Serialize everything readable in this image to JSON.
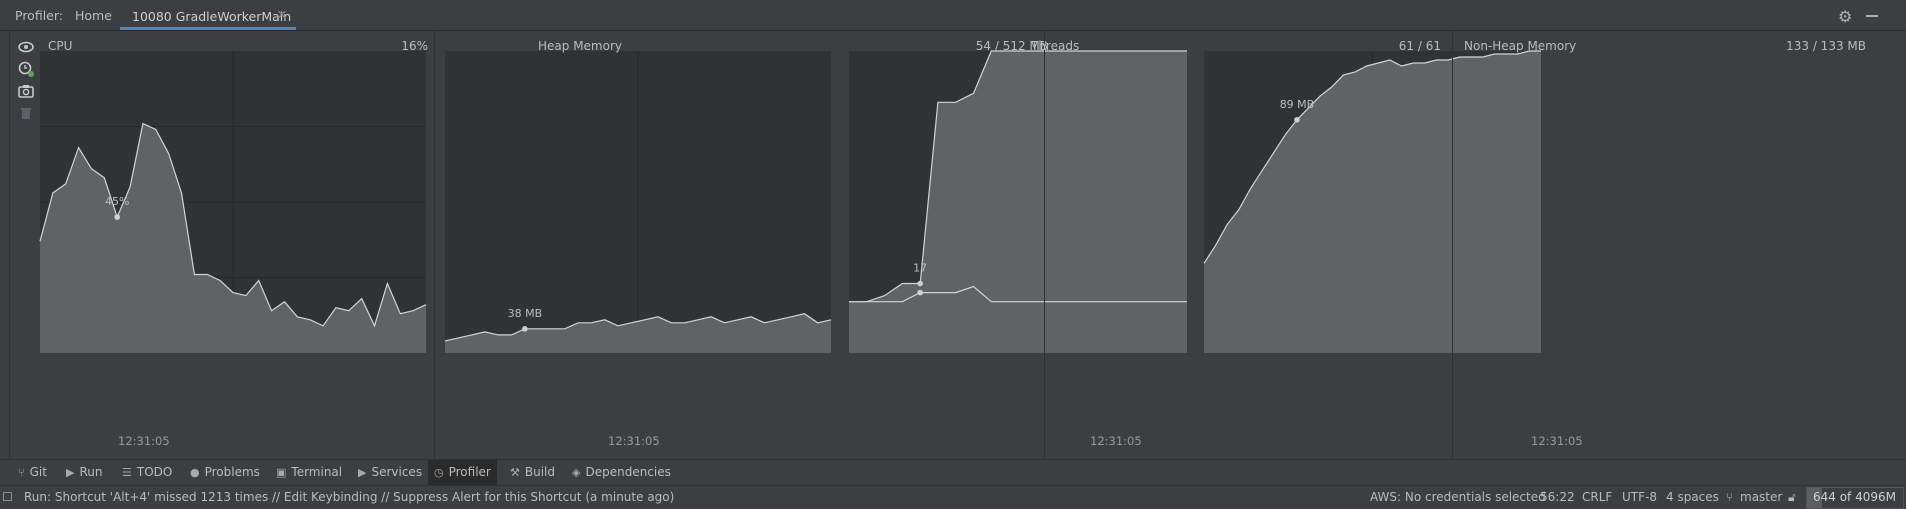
{
  "topbar": {
    "profiler_label": "Profiler:",
    "home_tab": "Home",
    "session_tab": "10080 GradleWorkerMain",
    "close_glyph": "×"
  },
  "panels": {
    "cpu": {
      "title": "CPU",
      "value": "16%",
      "marker_label": "45%",
      "time": "12:31:05"
    },
    "heap": {
      "title": "Heap Memory",
      "value": "54 / 512 MB",
      "marker_label": "38 MB",
      "time": "12:31:05"
    },
    "threads": {
      "title": "Threads",
      "value": "61 / 61",
      "marker_label": "17",
      "time": "12:31:05"
    },
    "nonheap": {
      "title": "Non-Heap Memory",
      "value": "133 / 133 MB",
      "marker_label": "89 MB",
      "time": "12:31:05"
    }
  },
  "chart_data": [
    {
      "type": "area",
      "title": "CPU",
      "unit": "%",
      "ylim": [
        0,
        100
      ],
      "values": [
        37,
        53,
        56,
        68,
        61,
        58,
        45,
        55,
        76,
        74,
        66,
        53,
        26,
        26,
        24,
        20,
        19,
        24,
        14,
        17,
        12,
        11,
        9,
        15,
        14,
        18,
        9,
        23,
        13,
        14,
        16
      ]
    },
    {
      "type": "area",
      "title": "Heap Memory",
      "unit": "MB",
      "values": [
        4,
        5,
        6,
        7,
        6,
        6,
        8,
        8,
        8,
        8,
        10,
        10,
        11,
        9,
        10,
        11,
        12,
        10,
        10,
        11,
        12,
        10,
        11,
        12,
        10,
        11,
        12,
        13,
        10,
        11
      ]
    },
    {
      "type": "area",
      "title": "Threads",
      "series": [
        {
          "name": "",
          "values": [
            17,
            17,
            19,
            23,
            23,
            83,
            83,
            86,
            100,
            100,
            100,
            100,
            100,
            100,
            100,
            100,
            100,
            100,
            100,
            100
          ]
        },
        {
          "name": "",
          "values": [
            17,
            17,
            17,
            17,
            17,
            17,
            17,
            17,
            17,
            17,
            17,
            17,
            17,
            17,
            17,
            17,
            17,
            17,
            17,
            17
          ]
        }
      ]
    },
    {
      "type": "area",
      "title": "Non-Heap Memory",
      "unit": "MB",
      "values": [
        30,
        36,
        43,
        48,
        55,
        61,
        67,
        73,
        78,
        82,
        86,
        89,
        93,
        94,
        96,
        97,
        98,
        96,
        97,
        97,
        98,
        98,
        99,
        99,
        99,
        100,
        100,
        100,
        101,
        101
      ]
    }
  ],
  "left_tools": [
    "eye-icon",
    "clock-icon",
    "camera-icon",
    "trash-icon"
  ],
  "toolwindows": [
    {
      "label": "Git",
      "icon": "⑂"
    },
    {
      "label": "Run",
      "icon": "▶"
    },
    {
      "label": "TODO",
      "icon": "☰"
    },
    {
      "label": "Problems",
      "icon": "●"
    },
    {
      "label": "Terminal",
      "icon": "▣"
    },
    {
      "label": "Services",
      "icon": "▶"
    },
    {
      "label": "Profiler",
      "icon": "◷"
    },
    {
      "label": "Build",
      "icon": "⚒"
    },
    {
      "label": "Dependencies",
      "icon": "◈"
    }
  ],
  "status": {
    "message": "Run: Shortcut 'Alt+4' missed 1213 times // Edit Keybinding // Suppress Alert for this Shortcut (a minute ago)",
    "aws": "AWS: No credentials selected",
    "position": "56:22",
    "line_sep": "CRLF",
    "encoding": "UTF-8",
    "indent": "4 spaces",
    "branch": "master",
    "memory": "644 of 4096M",
    "memory_fraction": 0.157
  },
  "colors": {
    "panel_bg": "#303234",
    "area_fill": "#616264",
    "line": "#d4d4d4",
    "accent": "#4a88c7"
  }
}
